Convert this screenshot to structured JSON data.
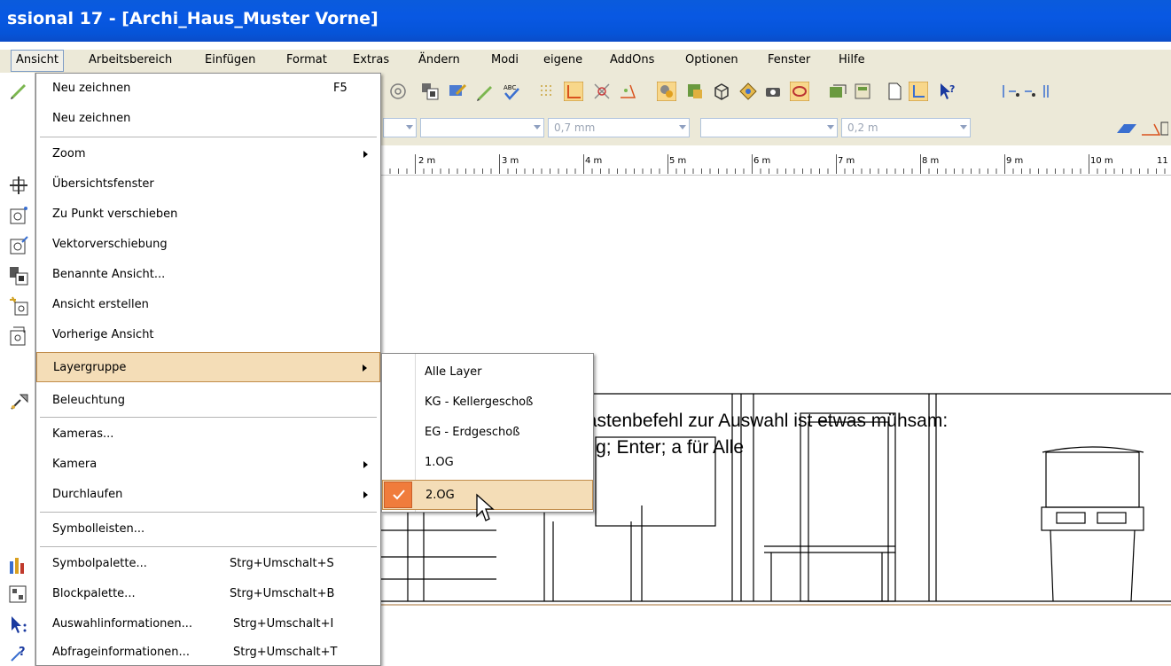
{
  "window": {
    "title": "ssional 17 - [Archi_Haus_Muster Vorne]"
  },
  "menubar": {
    "items": [
      {
        "label": "Ansicht"
      },
      {
        "label": "Arbeitsbereich"
      },
      {
        "label": "Einfügen"
      },
      {
        "label": "Format"
      },
      {
        "label": "Extras"
      },
      {
        "label": "Ändern"
      },
      {
        "label": "Modi"
      },
      {
        "label": "eigene"
      },
      {
        "label": "AddOns"
      },
      {
        "label": "Optionen"
      },
      {
        "label": "Fenster"
      },
      {
        "label": "Hilfe"
      }
    ]
  },
  "toolbar": {
    "combos": [
      {
        "value": ""
      },
      {
        "value": "0,7 mm"
      },
      {
        "value": ""
      },
      {
        "value": "0,2 m"
      }
    ]
  },
  "ruler": {
    "ticks": [
      "2 m",
      "3 m",
      "4 m",
      "5 m",
      "6 m",
      "7 m",
      "8 m",
      "9 m",
      "10 m",
      "11"
    ]
  },
  "annotation": {
    "line1": "Der Tastenbefehl zur Auswahl ist etwas mühsam:",
    "line2": "Alt+a; g; Enter; a  für Alle"
  },
  "ansicht_menu": {
    "items": [
      {
        "label": "Neu zeichnen",
        "shortcut": "F5",
        "icon": "pencil-icon"
      },
      {
        "label": "Neu zeichnen",
        "shortcut": ""
      },
      {
        "label": "Zoom",
        "submenu": true
      },
      {
        "label": "Übersichtsfenster",
        "icon": "overview-icon"
      },
      {
        "label": "Zu Punkt verschieben",
        "icon": "move-to-point-icon"
      },
      {
        "label": "Vektorverschiebung",
        "icon": "vector-move-icon"
      },
      {
        "label": "Benannte Ansicht...",
        "icon": "named-view-icon"
      },
      {
        "label": "Ansicht erstellen",
        "icon": "create-view-icon"
      },
      {
        "label": "Vorherige Ansicht",
        "icon": "previous-view-icon"
      },
      {
        "label": "Layergruppe",
        "submenu": true,
        "highlighted": true
      },
      {
        "label": "Beleuchtung",
        "icon": "lighting-icon"
      },
      {
        "label": "Kameras..."
      },
      {
        "label": "Kamera",
        "submenu": true
      },
      {
        "label": "Durchlaufen",
        "submenu": true
      },
      {
        "label": "Symbolleisten..."
      },
      {
        "label": "Symbolpalette...",
        "shortcut": "Strg+Umschalt+S",
        "icon": "symbol-palette-icon"
      },
      {
        "label": "Blockpalette...",
        "shortcut": "Strg+Umschalt+B",
        "icon": "block-palette-icon"
      },
      {
        "label": "Auswahlinformationen...",
        "shortcut": "Strg+Umschalt+I",
        "icon": "selection-info-icon"
      },
      {
        "label": "Abfrageinformationen...",
        "shortcut": "Strg+Umschalt+T",
        "icon": "query-info-icon"
      }
    ]
  },
  "layer_menu": {
    "items": [
      {
        "label": "Alle Layer"
      },
      {
        "label": "KG - Kellergeschoß"
      },
      {
        "label": "EG - Erdgeschoß"
      },
      {
        "label": "1.OG"
      },
      {
        "label": "2.OG",
        "checked": true,
        "highlighted": true
      }
    ]
  },
  "colors": {
    "titlebar": "#0858e3",
    "menu_highlight": "#f4ddb7",
    "check_accent": "#f07c3c"
  }
}
